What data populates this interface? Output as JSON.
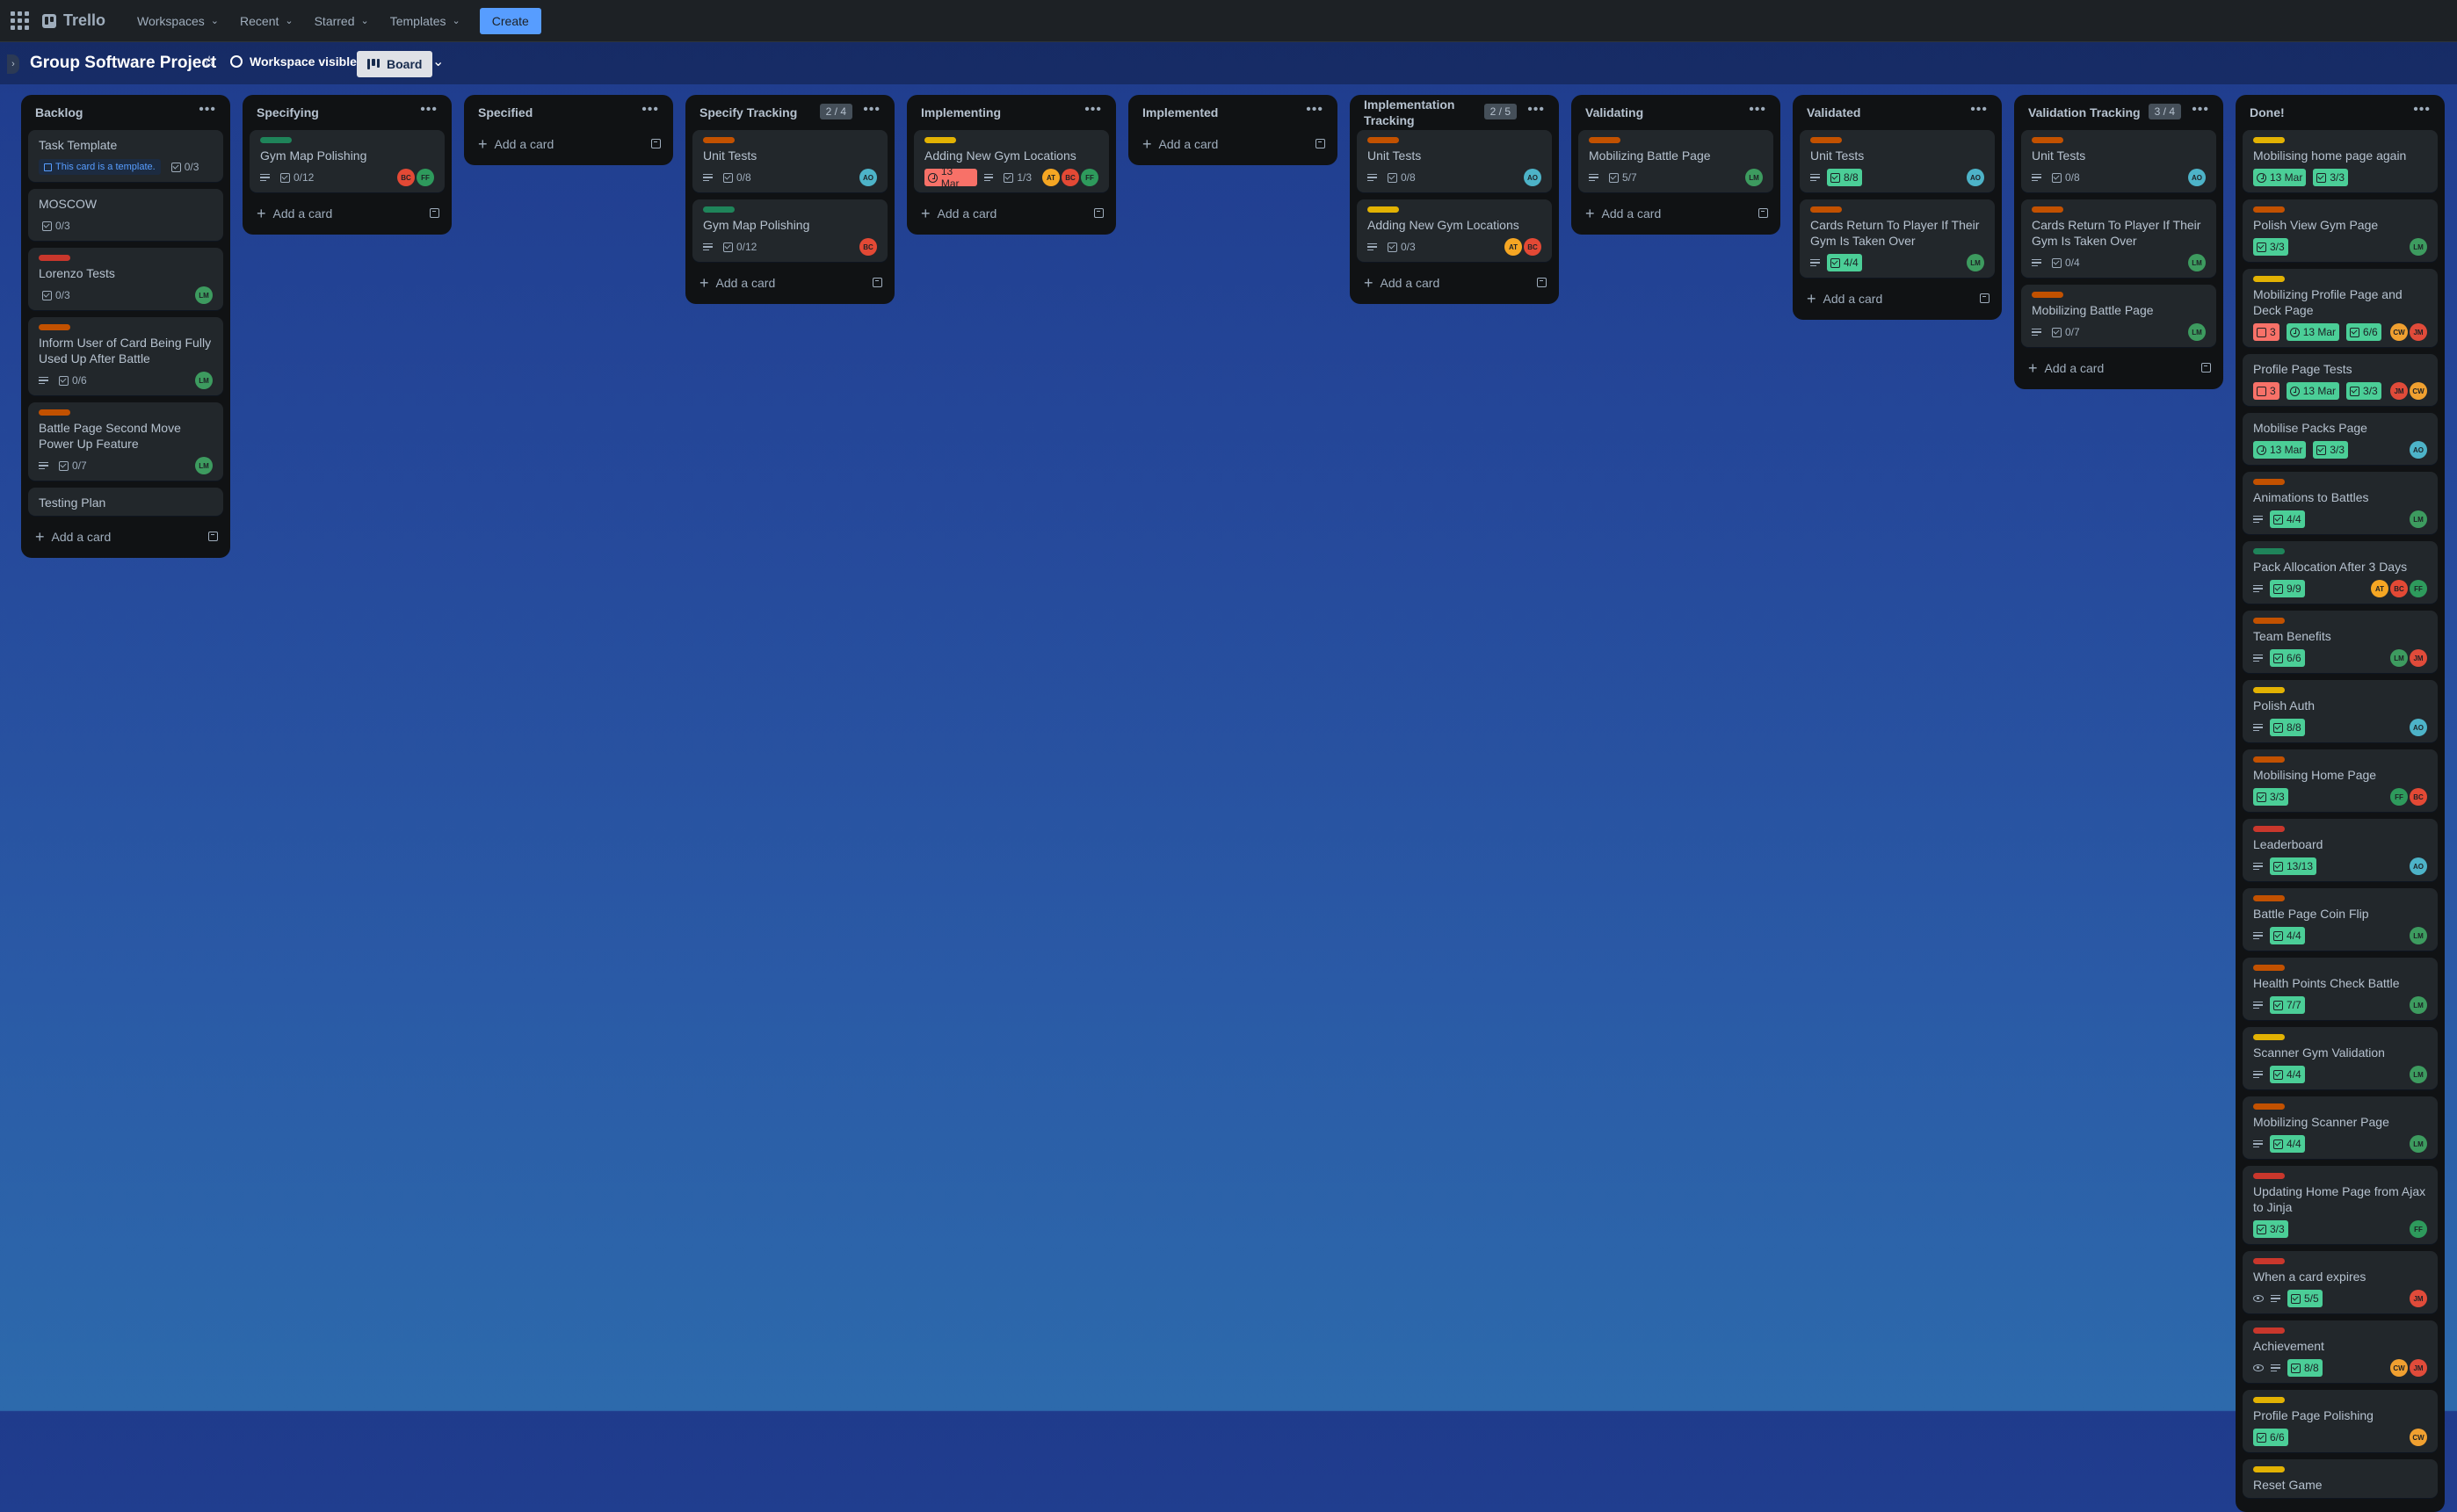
{
  "colors": {
    "green": "#4bce97",
    "red": "#f87168",
    "orange": "#e2652a",
    "yellow": "#e2b203",
    "darkred": "#c9372c",
    "darkgreen": "#1f845a",
    "darkorange": "#c25100",
    "avatar_bc": "#e34935",
    "avatar_ff": "#2e9a5c",
    "avatar_lm": "#3d9b5f",
    "avatar_ao": "#4db3c8",
    "avatar_at": "#f5a623",
    "avatar_cw": "#f0a030",
    "avatar_jm": "#e04b3a"
  },
  "nav": {
    "app_name": "Trello",
    "workspaces": "Workspaces",
    "recent": "Recent",
    "starred": "Starred",
    "templates": "Templates",
    "create": "Create"
  },
  "board": {
    "title": "Group Software Project",
    "visibility": "Workspace visible",
    "view": "Board"
  },
  "add_card": "Add a card",
  "template_text": "This card is a template.",
  "lists": [
    {
      "title": "Backlog",
      "count": "",
      "cards": [
        {
          "title": "Task Template",
          "template": true,
          "check": "0/3"
        },
        {
          "title": "MOSCOW",
          "check": "0/3"
        },
        {
          "label": "red",
          "title": "Lorenzo Tests",
          "check": "0/3",
          "avatars": [
            "LM"
          ]
        },
        {
          "label": "orange",
          "title": "Inform User of Card Being Fully Used Up After Battle",
          "desc": true,
          "check": "0/6",
          "avatars": [
            "LM"
          ]
        },
        {
          "label": "orange",
          "title": "Battle Page Second Move Power Up Feature",
          "desc": true,
          "check": "0/7",
          "avatars": [
            "LM"
          ]
        },
        {
          "title": "Testing Plan"
        }
      ]
    },
    {
      "title": "Specifying",
      "count": "",
      "cards": [
        {
          "label": "darkgreen",
          "title": "Gym Map Polishing",
          "desc": true,
          "check": "0/12",
          "avatars": [
            "BC",
            "FF"
          ]
        }
      ]
    },
    {
      "title": "Specified",
      "count": "",
      "cards": []
    },
    {
      "title": "Specify Tracking",
      "count": "2 / 4",
      "cards": [
        {
          "label": "orange",
          "title": "Unit Tests",
          "desc": true,
          "check": "0/8",
          "avatars": [
            "AO"
          ]
        },
        {
          "label": "darkgreen",
          "title": "Gym Map Polishing",
          "desc": true,
          "check": "0/12",
          "avatars": [
            "BC"
          ]
        }
      ]
    },
    {
      "title": "Implementing",
      "count": "",
      "cards": [
        {
          "label": "yellow",
          "title": "Adding New Gym Locations",
          "date": "13 Mar",
          "date_overdue": true,
          "desc": true,
          "check": "1/3",
          "avatars": [
            "AT",
            "BC",
            "FF"
          ]
        }
      ]
    },
    {
      "title": "Implemented",
      "count": "",
      "cards": []
    },
    {
      "title": "Implementation Tracking",
      "count": "2 / 5",
      "cards": [
        {
          "label": "orange",
          "title": "Unit Tests",
          "desc": true,
          "check": "0/8",
          "avatars": [
            "AO"
          ]
        },
        {
          "label": "yellow",
          "title": "Adding New Gym Locations",
          "desc": true,
          "check": "0/3",
          "avatars": [
            "AT",
            "BC"
          ]
        }
      ]
    },
    {
      "title": "Validating",
      "count": "",
      "cards": [
        {
          "label": "orange",
          "title": "Mobilizing Battle Page",
          "desc": true,
          "check": "5/7",
          "avatars": [
            "LM"
          ]
        }
      ]
    },
    {
      "title": "Validated",
      "count": "",
      "cards": [
        {
          "label": "orange",
          "title": "Unit Tests",
          "desc": true,
          "check": "8/8",
          "done": true,
          "avatars": [
            "AO"
          ]
        },
        {
          "label": "orange",
          "title": "Cards Return To Player If Their Gym Is Taken Over",
          "desc": true,
          "check": "4/4",
          "done": true,
          "avatars": [
            "LM"
          ]
        }
      ]
    },
    {
      "title": "Validation Tracking",
      "count": "3 / 4",
      "cards": [
        {
          "label": "orange",
          "title": "Unit Tests",
          "desc": true,
          "check": "0/8",
          "avatars": [
            "AO"
          ]
        },
        {
          "label": "orange",
          "title": "Cards Return To Player If Their Gym Is Taken Over",
          "desc": true,
          "check": "0/4",
          "avatars": [
            "LM"
          ]
        },
        {
          "label": "orange",
          "title": "Mobilizing Battle Page",
          "desc": true,
          "check": "0/7",
          "avatars": [
            "LM"
          ]
        }
      ]
    },
    {
      "title": "Done!",
      "count": "",
      "cards": [
        {
          "label": "yellow",
          "title": "Mobilising home page again",
          "date": "13 Mar",
          "date_done": true,
          "check": "3/3",
          "done": true
        },
        {
          "label": "orange",
          "title": "Polish View Gym Page",
          "check": "3/3",
          "done": true,
          "avatars": [
            "LM"
          ]
        },
        {
          "label": "yellow",
          "title": "Mobilizing Profile Page and Deck Page",
          "alerts": "3",
          "date": "13 Mar",
          "date_done": true,
          "check": "6/6",
          "done": true,
          "avatars": [
            "CW",
            "JM"
          ]
        },
        {
          "title": "Profile Page Tests",
          "alerts": "3",
          "date": "13 Mar",
          "date_done": true,
          "check": "3/3",
          "done": true,
          "avatars": [
            "JM",
            "CW"
          ]
        },
        {
          "title": "Mobilise Packs Page",
          "date": "13 Mar",
          "date_done": true,
          "check": "3/3",
          "done": true,
          "avatars": [
            "AO"
          ]
        },
        {
          "label": "orange",
          "title": "Animations to Battles",
          "desc": true,
          "check": "4/4",
          "done": true,
          "avatars": [
            "LM"
          ]
        },
        {
          "label": "darkgreen",
          "title": "Pack Allocation After 3 Days",
          "desc": true,
          "check": "9/9",
          "done": true,
          "avatars": [
            "AT",
            "BC",
            "FF"
          ]
        },
        {
          "label": "orange",
          "title": "Team Benefits",
          "desc": true,
          "check": "6/6",
          "done": true,
          "avatars": [
            "LM",
            "JM"
          ]
        },
        {
          "label": "yellow",
          "title": "Polish Auth",
          "desc": true,
          "check": "8/8",
          "done": true,
          "avatars": [
            "AO"
          ]
        },
        {
          "label": "orange",
          "title": "Mobilising Home Page",
          "check": "3/3",
          "done": true,
          "avatars": [
            "FF",
            "BC"
          ]
        },
        {
          "label": "red",
          "title": "Leaderboard",
          "desc": true,
          "check": "13/13",
          "done": true,
          "avatars": [
            "AO"
          ]
        },
        {
          "label": "orange",
          "title": "Battle Page Coin Flip",
          "desc": true,
          "check": "4/4",
          "done": true,
          "avatars": [
            "LM"
          ]
        },
        {
          "label": "orange",
          "title": "Health Points Check Battle",
          "desc": true,
          "check": "7/7",
          "done": true,
          "avatars": [
            "LM"
          ]
        },
        {
          "label": "yellow",
          "title": "Scanner Gym Validation",
          "desc": true,
          "check": "4/4",
          "done": true,
          "avatars": [
            "LM"
          ]
        },
        {
          "label": "orange",
          "title": "Mobilizing Scanner Page",
          "desc": true,
          "check": "4/4",
          "done": true,
          "avatars": [
            "LM"
          ]
        },
        {
          "label": "red",
          "title": "Updating Home Page from Ajax to Jinja",
          "check": "3/3",
          "done": true,
          "avatars": [
            "FF"
          ]
        },
        {
          "label": "red",
          "title": "When a card expires",
          "watch": true,
          "desc": true,
          "check": "5/5",
          "done": true,
          "avatars": [
            "JM"
          ]
        },
        {
          "label": "red",
          "title": "Achievement",
          "watch": true,
          "desc": true,
          "check": "8/8",
          "done": true,
          "avatars": [
            "CW",
            "JM"
          ]
        },
        {
          "label": "yellow",
          "title": "Profile Page Polishing",
          "check": "6/6",
          "done": true,
          "avatars": [
            "CW"
          ]
        },
        {
          "label": "yellow",
          "title": "Reset Game"
        }
      ]
    }
  ]
}
